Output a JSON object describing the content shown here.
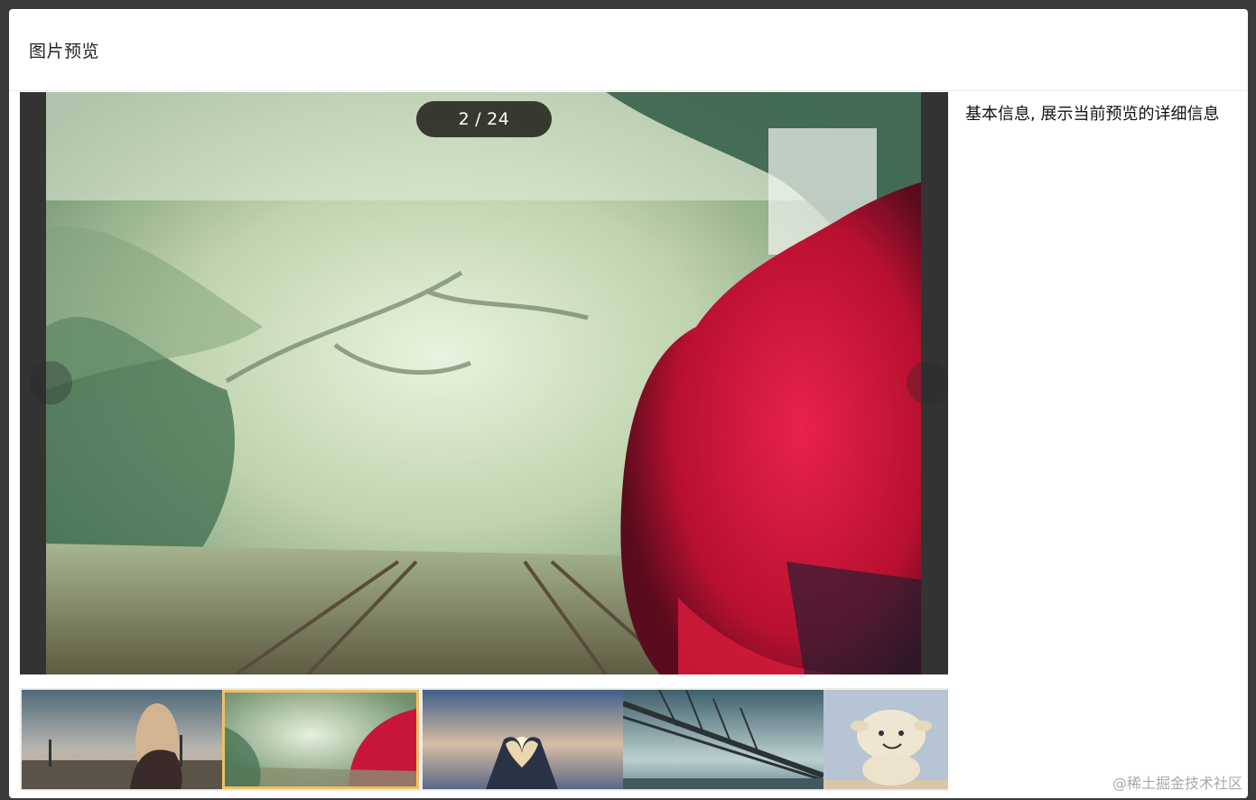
{
  "modal": {
    "title": "图片预览"
  },
  "viewer": {
    "current": "2",
    "separator": "/",
    "total": "24",
    "prev_icon": "chevron-left-icon",
    "next_icon": "chevron-right-icon"
  },
  "info_panel": {
    "text": "基本信息, 展示当前预览的详细信息"
  },
  "thumbnails": {
    "active_index": 2,
    "items": [
      {
        "subject": "girl-by-river"
      },
      {
        "subject": "misty-railway-red-flowers"
      },
      {
        "subject": "heart-hands-sunset"
      },
      {
        "subject": "bridge"
      },
      {
        "subject": "plush-sheep-toy"
      }
    ]
  },
  "watermark": "@稀土掘金技术社区",
  "colors": {
    "thumb_active_border": "#f0c060",
    "viewer_background": "#333333"
  }
}
